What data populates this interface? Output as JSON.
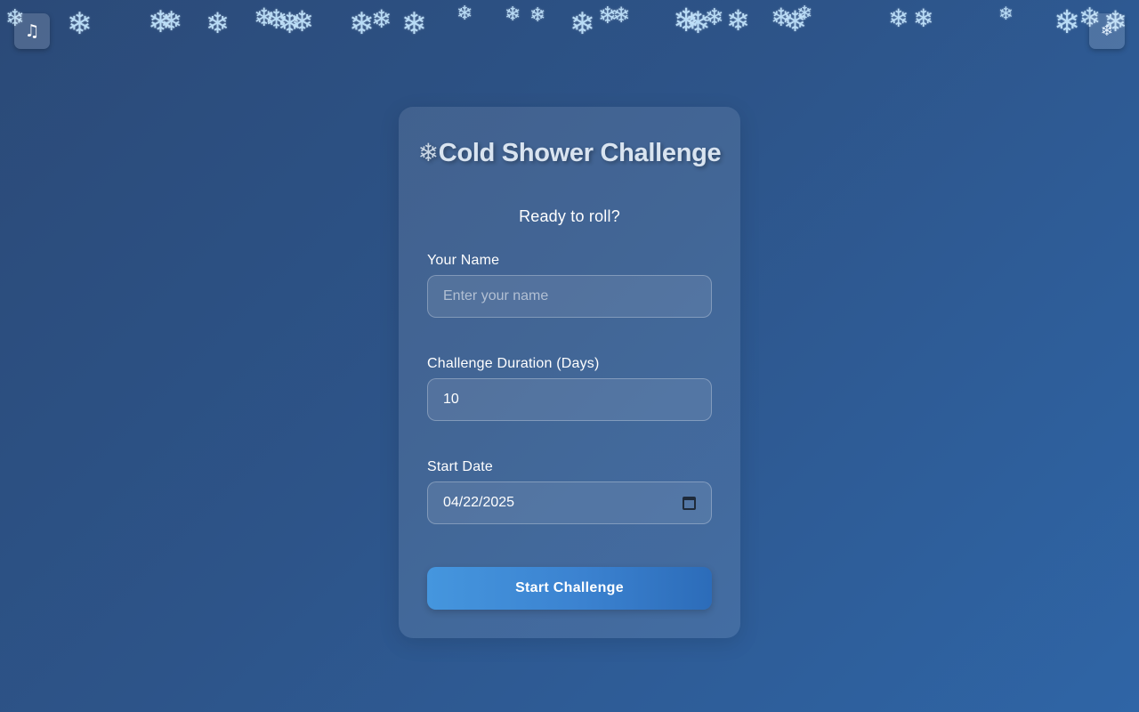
{
  "controls": {
    "music_icon": "♫",
    "snow_icon": "❄"
  },
  "header": {
    "title_icon": "❄",
    "title": "Cold Shower Challenge",
    "subtitle": "Ready to roll?"
  },
  "form": {
    "name": {
      "label": "Your Name",
      "placeholder": "Enter your name",
      "value": ""
    },
    "duration": {
      "label": "Challenge Duration (Days)",
      "value": "10"
    },
    "start_date": {
      "label": "Start Date",
      "value": "04/22/2025"
    },
    "submit_label": "Start Challenge"
  },
  "decoration": {
    "snowflake_glyph": "❄",
    "snowflake_color": "#b9dcf6"
  },
  "colors": {
    "background_top": "#2b4a78",
    "background_bottom": "#2f65a6",
    "button_accent": "#3b82d0"
  }
}
